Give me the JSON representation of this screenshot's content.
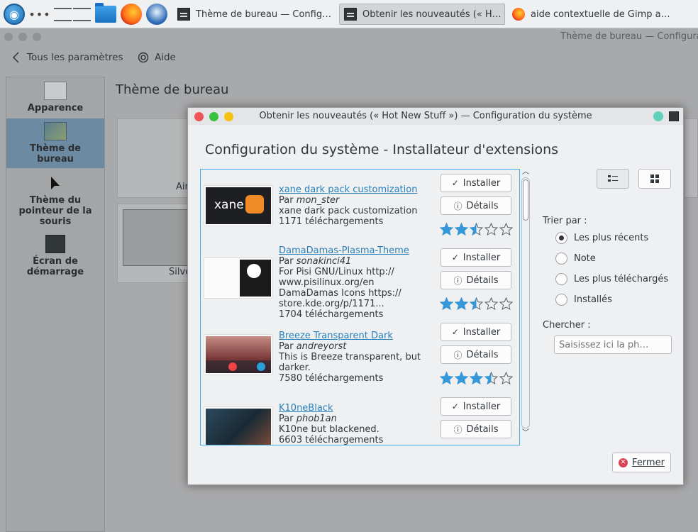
{
  "taskbar": {
    "tasks": [
      {
        "label": "Thème de bureau  — Config…"
      },
      {
        "label": "Obtenir les nouveautés (« H…"
      },
      {
        "label": "aide contextuelle de Gimp a…"
      }
    ]
  },
  "settings": {
    "window_title": "Thème de bureau — Configura",
    "back_label": "Tous les paramètres",
    "help_label": "Aide",
    "page_heading": "Thème de bureau",
    "sidebar": [
      {
        "label": "Apparence"
      },
      {
        "label": "Thème de bureau"
      },
      {
        "label": "Thème du pointeur de la souris"
      },
      {
        "label": "Écran de démarrage"
      }
    ],
    "card_labels": [
      "Air",
      "Silve"
    ]
  },
  "dialog": {
    "title": "Obtenir les nouveautés (« Hot New Stuff ») — Configuration du système",
    "heading": "Configuration du système - Installateur d'extensions",
    "install_label": "Installer",
    "details_label": "Détails",
    "by_prefix": "Par",
    "entries": [
      {
        "name": "xane dark pack customization",
        "author": "mon_ster",
        "desc": [
          "xane dark pack customization"
        ],
        "downloads": "1171 téléchargements",
        "rating": 2.5,
        "thumb_text": "xane"
      },
      {
        "name": "DamaDamas-Plasma-Theme",
        "author": "sonakinci41",
        "desc": [
          "For Pisi GNU/Linux http://",
          "www.pisilinux.org/en",
          "DamaDamas Icons https://",
          "store.kde.org/p/1171..."
        ],
        "downloads": "1704 téléchargements",
        "rating": 2.5
      },
      {
        "name": "Breeze Transparent Dark",
        "author": "andreyorst",
        "desc": [
          "This is Breeze transparent, but",
          "darker."
        ],
        "downloads": "7580 téléchargements",
        "rating": 3.5
      },
      {
        "name": "K10neBlack",
        "author": "phob1an",
        "desc": [
          "K10ne but blackened."
        ],
        "downloads": "6603 téléchargements",
        "rating": null
      }
    ],
    "sort_label": "Trier par :",
    "sort_options": [
      {
        "label": "Les plus récents",
        "selected": true
      },
      {
        "label": "Note",
        "selected": false
      },
      {
        "label": "Les plus téléchargés",
        "selected": false
      },
      {
        "label": "Installés",
        "selected": false
      }
    ],
    "search_label": "Chercher :",
    "search_placeholder": "Saisissez ici la ph…",
    "close_label": "Fermer"
  },
  "colors": {
    "accent": "#3daee9",
    "link": "#2980b9",
    "star": "#3498db"
  }
}
